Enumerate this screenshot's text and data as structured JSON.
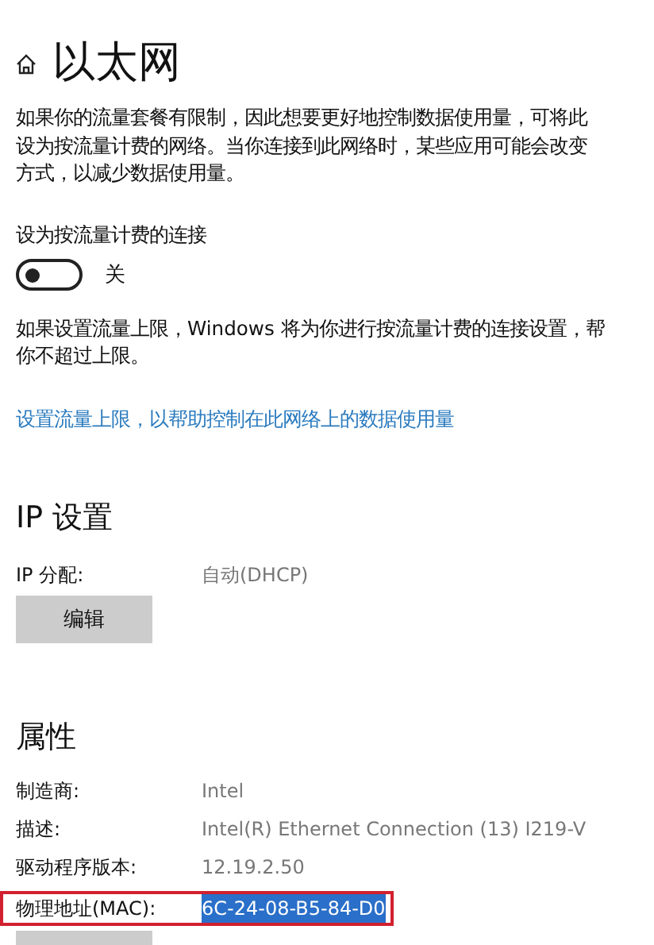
{
  "header": {
    "title": "以太网"
  },
  "metered_intro": [
    "如果你的流量套餐有限制，因此想要更好地控制数据使用量，可将此",
    "设为按流量计费的网络。当你连接到此网络时，某些应用可能会改变",
    "方式，以减少数据使用量。"
  ],
  "metered_setting": {
    "label": "设为按流量计费的连接",
    "on": false,
    "state_text": "关"
  },
  "limit_note": [
    "如果设置流量上限，Windows 将为你进行按流量计费的连接设置，帮",
    "你不超过上限。"
  ],
  "limit_link": "设置流量上限，以帮助控制在此网络上的数据使用量",
  "ip_settings": {
    "heading": "IP 设置",
    "rows": [
      {
        "label": "IP 分配:",
        "value": "自动(DHCP)"
      }
    ],
    "button": "编辑"
  },
  "properties": {
    "heading": "属性",
    "rows": [
      {
        "label": "制造商:",
        "value": "Intel",
        "highlighted": false,
        "selected": false
      },
      {
        "label": "描述:",
        "value": "Intel(R) Ethernet Connection (13) I219-V",
        "highlighted": false,
        "selected": false
      },
      {
        "label": "驱动程序版本:",
        "value": "12.19.2.50",
        "highlighted": false,
        "selected": false
      },
      {
        "label": "物理地址(MAC):",
        "value": "6C-24-08-B5-84-D0",
        "highlighted": true,
        "selected": true
      }
    ]
  }
}
